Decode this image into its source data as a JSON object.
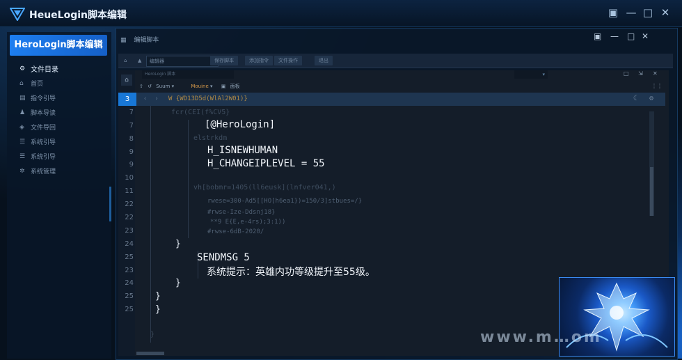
{
  "app": {
    "title": "HeueLogin脚本编辑"
  },
  "sidebar": {
    "brand": "HeroLogin脚本编辑",
    "items": [
      {
        "label": "文件目录",
        "icon": "gear-icon",
        "active": true
      },
      {
        "label": "首页",
        "icon": "home-icon"
      },
      {
        "label": "指令引导",
        "icon": "file-icon"
      },
      {
        "label": "脚本导读",
        "icon": "user-icon"
      },
      {
        "label": "文件导回",
        "icon": "shield-icon"
      },
      {
        "label": "系统引导",
        "icon": "list-icon"
      },
      {
        "label": "系统引导",
        "icon": "list-icon"
      },
      {
        "label": "系统管理",
        "icon": "settings-icon"
      }
    ]
  },
  "main": {
    "heading": "编辑脚本"
  },
  "toolbar": {
    "dropdown": "编辑器",
    "buttons": [
      "保存脚本",
      "添加指令",
      "文件操作",
      "退出"
    ]
  },
  "editor": {
    "tab": "HeroLogin 脚本",
    "search": "",
    "tools": {
      "group1": "Suum",
      "group2": "Mouine",
      "group3": "面板"
    },
    "line_numbers": [
      "3",
      "7",
      "7",
      "8",
      "9",
      "9",
      "10",
      "11",
      "22",
      "22",
      "23",
      "24",
      "25",
      "23",
      "24",
      "25",
      "25"
    ],
    "active_line": "3",
    "lines": {
      "l3": "W {WD13D5d(WlAl2W01)}",
      "l7a": "fcr(CEI(f%CV5}",
      "l7b": "[@HeroLogin]",
      "l8a": "elstrkdm",
      "l8b": "H_ISNEWHUMAN",
      "l9": "H_CHANGEIPLEVEL = 55",
      "l10": "vh[bobmr=1405(ll6eusk](lnfver041,)",
      "l11": "rwese=300-Ad5[[HO[h6ea1})=150/3]stbues=/}",
      "l22a": "#rwse-Ize-Ddsnj18}",
      "l22b": "**9 E{E,e-4rs);3:1))",
      "l22c": "#rwse-6dB-2020/",
      "l23": "}",
      "l24": "SENDMSG 5",
      "l25": "系统提示：英雄内功等级提升至55级。",
      "b1": "}",
      "b2": "}",
      "b3": "}",
      "b4": "}"
    }
  },
  "watermark": "www.m…om"
}
